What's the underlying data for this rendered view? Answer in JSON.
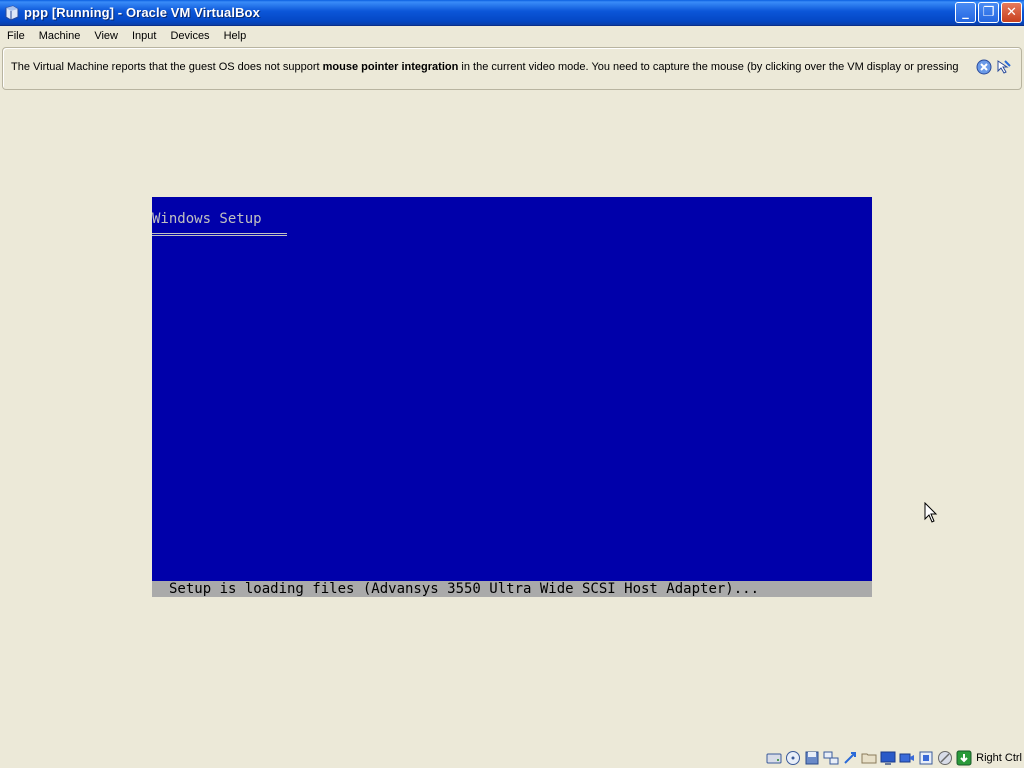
{
  "window": {
    "title": "ppp [Running] - Oracle VM VirtualBox",
    "minimize_glyph": "_",
    "restore_glyph": "❐",
    "close_glyph": "✕"
  },
  "menu": {
    "items": [
      "File",
      "Machine",
      "View",
      "Input",
      "Devices",
      "Help"
    ]
  },
  "notice": {
    "text_before": "The Virtual Machine reports that the guest OS does not support ",
    "text_bold": "mouse pointer integration",
    "text_after": " in the current video mode. You need to capture the mouse (by clicking over the VM display or pressing"
  },
  "vm": {
    "screen_title": "Windows Setup",
    "status_line": "Setup is loading files (Advansys 3550 Ultra Wide SCSI Host Adapter)...",
    "bg_color": "#0000aa",
    "status_bg": "#aaaaaa"
  },
  "statusbar": {
    "icons": [
      "hard-disk-icon",
      "optical-drive-icon",
      "floppy-icon",
      "network-icon",
      "usb-icon",
      "shared-folders-icon",
      "display-icon",
      "video-capture-icon",
      "vrde-icon",
      "mouse-integration-icon",
      "host-key-icon"
    ],
    "host_key": "Right Ctrl"
  }
}
